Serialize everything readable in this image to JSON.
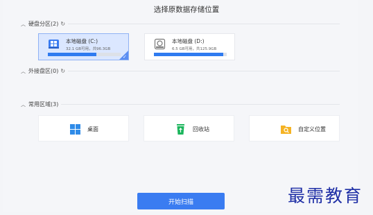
{
  "title": "选择原数据存储位置",
  "sections": {
    "disks": {
      "label": "硬盘分区(2)"
    },
    "external": {
      "label": "外接盘区(0)"
    },
    "common": {
      "label": "常用区域(3)"
    }
  },
  "disks": [
    {
      "name": "本地磁盘 (C:)",
      "info": "32.1 GB可用，共96.3GB",
      "used_fraction": 0.67,
      "selected": true,
      "icon": "windows-drive-icon"
    },
    {
      "name": "本地磁盘 (D:)",
      "info": "6.5 GB可用，共125.9GB",
      "used_fraction": 0.95,
      "selected": false,
      "icon": "hard-drive-icon"
    }
  ],
  "quick_access": [
    {
      "label": "桌面",
      "icon": "windows-logo-icon"
    },
    {
      "label": "回收站",
      "icon": "recycle-bin-icon"
    },
    {
      "label": "自定义位置",
      "icon": "folder-search-icon"
    }
  ],
  "scan_button": "开始扫描",
  "watermark": "最需教育",
  "colors": {
    "accent": "#3a7cf1",
    "selected_bg": "#dbe7ff",
    "recycle": "#1bb55c",
    "folder": "#f5b324"
  }
}
